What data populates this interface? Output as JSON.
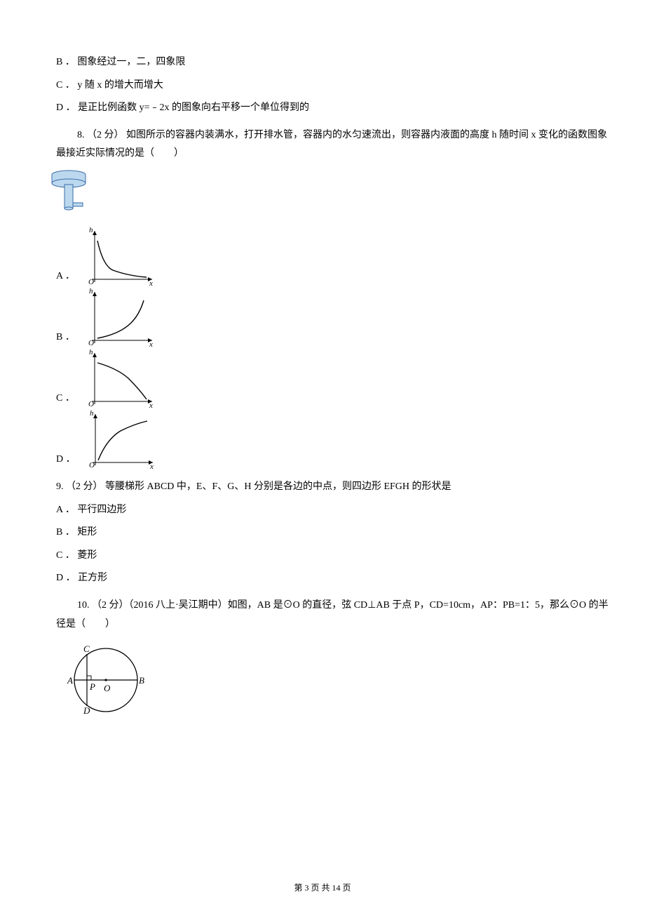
{
  "optB": "B ． 图象经过一，二，四象限",
  "optC": "C ． y 随 x 的增大而增大",
  "optD": "D ． 是正比例函数 y=﹣2x 的图象向右平移一个单位得到的",
  "q8": {
    "text": "8. （2 分） 如图所示的容器内装满水，打开排水管，容器内的水匀速流出，则容器内液面的高度 h 随时间 x 变化的函数图象最接近实际情况的是（　　）",
    "options": {
      "A": "A ．",
      "B": "B ．",
      "C": "C ．",
      "D": "D ．"
    }
  },
  "q9": {
    "text": "9. （2 分） 等腰梯形 ABCD 中，E、F、G、H 分别是各边的中点，则四边形 EFGH 的形状是",
    "options": {
      "A": "A ． 平行四边形",
      "B": "B ． 矩形",
      "C": "C ． 菱形",
      "D": "D ． 正方形"
    }
  },
  "q10": {
    "text": "10. （2 分）（2016 八上·吴江期中）如图，AB 是⊙O 的直径，弦 CD⊥AB 于点 P，CD=10cm，AP：PB=1：5，那么⊙O 的半径是（　　）"
  },
  "footer": "第 3 页 共 14 页",
  "chart_data": [
    {
      "type": "diagram",
      "name": "q8-container",
      "description": "Cylindrical container with wide top disc and narrow stem, drain pipe at bottom"
    },
    {
      "type": "line",
      "name": "q8-option-A",
      "xlabel": "x",
      "ylabel": "h",
      "description": "h vs time: starts high, steep decrease then shallow decrease (concave down)",
      "x": [
        0,
        0.3,
        1.0
      ],
      "y": [
        1.0,
        0.25,
        0.05
      ]
    },
    {
      "type": "line",
      "name": "q8-option-B",
      "xlabel": "x",
      "ylabel": "h",
      "description": "h vs time: increasing concave up from low to high",
      "x": [
        0,
        0.6,
        1.0
      ],
      "y": [
        0.05,
        0.25,
        1.0
      ]
    },
    {
      "type": "line",
      "name": "q8-option-C",
      "xlabel": "x",
      "ylabel": "h",
      "description": "h vs time: starts high, shallow decrease then steep decrease (concave down opposite of A)",
      "x": [
        0,
        0.6,
        1.0
      ],
      "y": [
        1.0,
        0.75,
        0.05
      ]
    },
    {
      "type": "line",
      "name": "q8-option-D",
      "xlabel": "x",
      "ylabel": "h",
      "description": "h vs time: increasing concave down from low to high",
      "x": [
        0,
        0.4,
        1.0
      ],
      "y": [
        0.05,
        0.6,
        1.0
      ]
    },
    {
      "type": "diagram",
      "name": "q10-circle",
      "labels": [
        "A",
        "B",
        "C",
        "D",
        "P",
        "O"
      ],
      "description": "Circle with center O, horizontal diameter AB, vertical chord CD perpendicular to AB at point P (left of center)"
    }
  ]
}
